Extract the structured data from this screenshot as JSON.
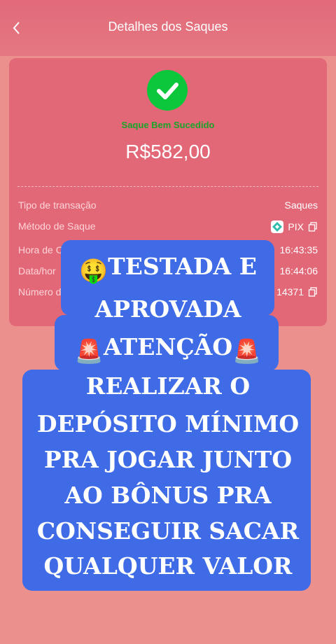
{
  "header": {
    "title": "Detalhes dos Saques"
  },
  "receipt": {
    "status": "Saque Bem Sucedido",
    "amount": "R$582,00",
    "rows": [
      {
        "label": "Tipo de transação",
        "value": "Saques"
      },
      {
        "label": "Método de Saque",
        "value": "PIX"
      },
      {
        "label": "Hora de C",
        "value": "16:43:35"
      },
      {
        "label": "Data/hor",
        "value": "16:44:06"
      },
      {
        "label": "Número d",
        "value": "14371"
      }
    ]
  },
  "overlay": {
    "lines": [
      "TESTADA E",
      "APROVADA",
      "ATENÇÃO",
      "REALIZAR O",
      "DEPÓSITO MÍNIMO",
      "PRA JOGAR JUNTO",
      "AO BÔNUS PRA",
      "CONSEGUIR SACAR",
      "QUALQUER VALOR"
    ],
    "emoji_money": "🤑",
    "emoji_siren": "🚨"
  },
  "colors": {
    "background": "#ec908e",
    "header": "#e26a7b",
    "card": "#e26777",
    "success": "#0cc73c",
    "overlay": "#3f6ce6"
  },
  "icons": [
    "back-arrow-icon",
    "check-icon",
    "pix-icon",
    "copy-icon",
    "money-face-emoji",
    "siren-emoji"
  ]
}
